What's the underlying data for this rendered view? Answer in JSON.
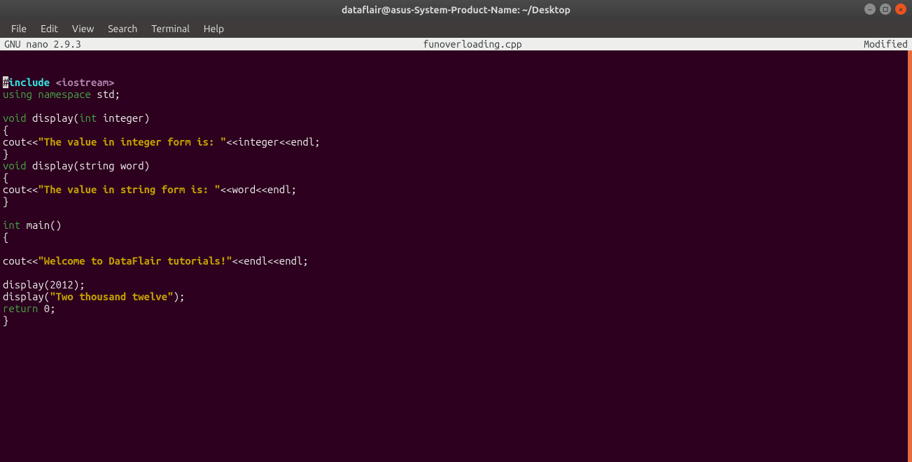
{
  "titlebar": {
    "title": "dataflair@asus-System-Product-Name: ~/Desktop"
  },
  "menubar": {
    "items": [
      "File",
      "Edit",
      "View",
      "Search",
      "Terminal",
      "Help"
    ]
  },
  "nano": {
    "app_label": "  GNU nano 2.9.3",
    "filename": "funoverloading.cpp",
    "modified_label": "Modified"
  },
  "code": {
    "l1_hash": "#",
    "l1_include": "include",
    "l1_sp": " ",
    "l1_header": "<iostream>",
    "l2_using": "using",
    "l2_sp1": " ",
    "l2_ns": "namespace",
    "l2_std": " std;",
    "l3": "",
    "l4_void": "void",
    "l4_rest_a": " display(",
    "l4_int": "int",
    "l4_rest_b": " integer)",
    "l5": "{",
    "l6_a": "cout<<",
    "l6_str": "\"The value in integer form is: \"",
    "l6_b": "<<integer<<endl;",
    "l7": "}",
    "l8_void": "void",
    "l8_rest": " display(string word)",
    "l9": "{",
    "l10_a": "cout<<",
    "l10_str": "\"The value in string form is: \"",
    "l10_b": "<<word<<endl;",
    "l11": "}",
    "l12": "",
    "l13_int": "int",
    "l13_rest": " main()",
    "l14": "{",
    "l15": "",
    "l16_a": "cout<<",
    "l16_str": "\"Welcome to DataFlair tutorials!\"",
    "l16_b": "<<endl<<endl;",
    "l17": "",
    "l18": "display(2012);",
    "l19_a": "display(",
    "l19_str": "\"Two thousand twelve\"",
    "l19_b": ");",
    "l20_ret": "return",
    "l20_rest": " 0;",
    "l21": "}"
  }
}
